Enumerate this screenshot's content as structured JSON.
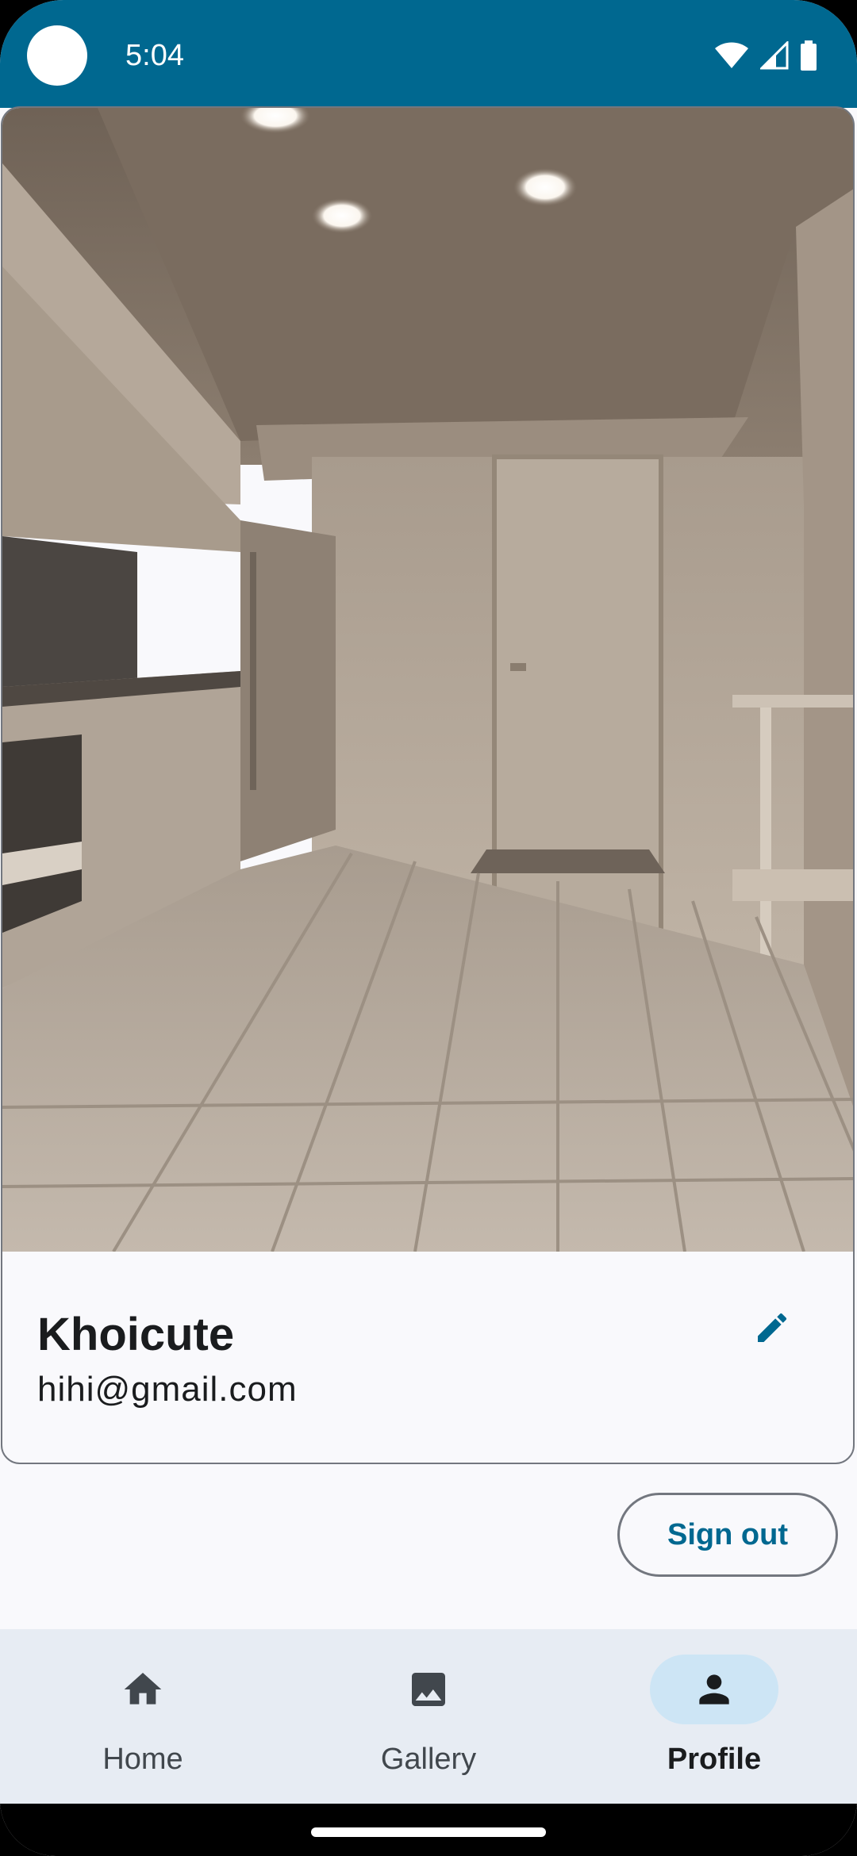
{
  "status_bar": {
    "time": "5:04",
    "icons": [
      "wifi-icon",
      "cell-signal-icon",
      "battery-icon"
    ],
    "background": "#006890"
  },
  "profile": {
    "name": "Khoicute",
    "email": "hihi@gmail.com",
    "photo": "kitchen-room-photo",
    "edit_icon": "pencil-icon"
  },
  "actions": {
    "sign_out_label": "Sign out"
  },
  "bottom_nav": {
    "items": [
      {
        "label": "Home",
        "icon": "home-icon",
        "selected": false
      },
      {
        "label": "Gallery",
        "icon": "image-icon",
        "selected": false
      },
      {
        "label": "Profile",
        "icon": "person-icon",
        "selected": true
      }
    ]
  },
  "colors": {
    "accent": "#006890",
    "nav_background": "#e7ecf3",
    "selected_indicator": "#cde5f5"
  }
}
